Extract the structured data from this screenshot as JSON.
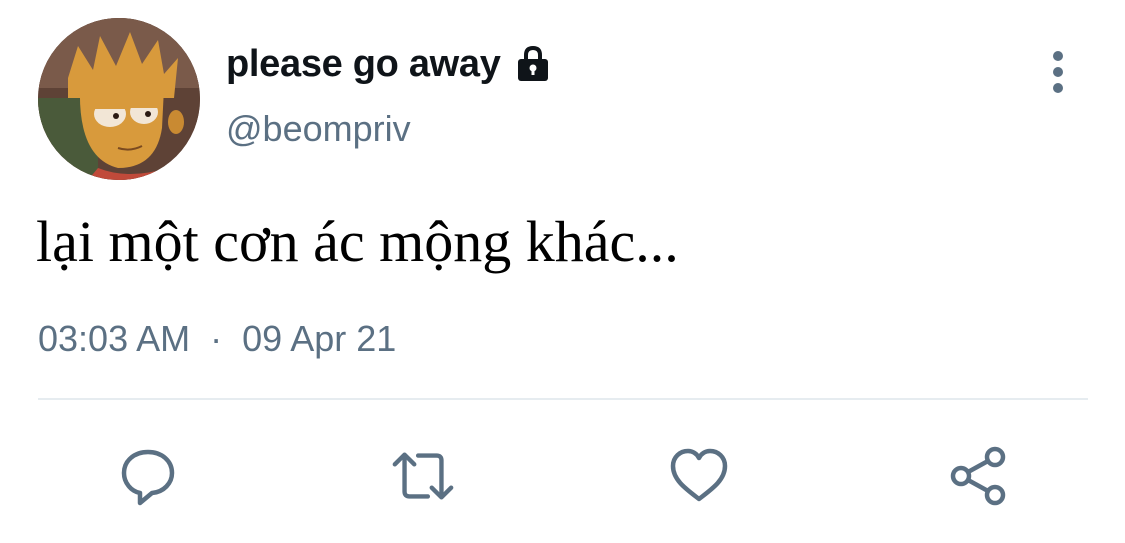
{
  "tweet": {
    "display_name": "please go away",
    "handle": "@beompriv",
    "text": "lại một cơn ác mộng khác...",
    "time": "03:03 AM",
    "separator": "·",
    "date": "09 Apr 21",
    "protected_icon": "lock-icon"
  },
  "actions": [
    {
      "name": "reply",
      "icon": "comment-icon"
    },
    {
      "name": "retweet",
      "icon": "retweet-icon"
    },
    {
      "name": "like",
      "icon": "heart-icon"
    },
    {
      "name": "share",
      "icon": "share-icon"
    }
  ],
  "colors": {
    "text_primary": "#0f1419",
    "text_secondary": "#5b7083",
    "icon_gray": "#5b7083",
    "divider": "#e6ecf0"
  }
}
